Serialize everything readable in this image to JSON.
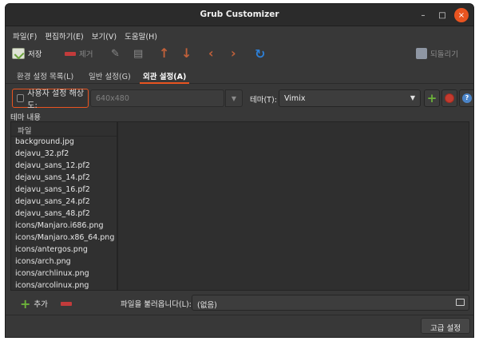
{
  "window": {
    "title": "Grub Customizer"
  },
  "window_controls": {
    "minimize": "–",
    "maximize": "□",
    "close": "×"
  },
  "menubar": [
    {
      "label": "파일(F)"
    },
    {
      "label": "편집하기(E)"
    },
    {
      "label": "보기(V)"
    },
    {
      "label": "도움말(H)"
    }
  ],
  "toolbar": {
    "save_label": "저장",
    "remove_label": "제거",
    "revert_label": "되돌리기",
    "icons": [
      "save-icon",
      "remove-icon",
      "edit-icon",
      "create-entry-icon",
      "arrow-up-icon",
      "arrow-down-icon",
      "arrow-left-icon",
      "arrow-right-icon",
      "reload-icon",
      "revert-icon"
    ]
  },
  "tabs": [
    {
      "label": "환경 설정 목록(L)",
      "active": false
    },
    {
      "label": "일반 설정(G)",
      "active": false
    },
    {
      "label": "외관 설정(A)",
      "active": true
    }
  ],
  "appearance": {
    "custom_resolution_label": "사용자 설정 해상도:",
    "custom_resolution_checked": false,
    "resolution_placeholder": "640x480",
    "theme_label": "테마(T):",
    "theme_value": "Vimix"
  },
  "theme_contents": {
    "section_label": "테마 내용",
    "column_header": "파일",
    "files": [
      "background.jpg",
      "dejavu_32.pf2",
      "dejavu_sans_12.pf2",
      "dejavu_sans_14.pf2",
      "dejavu_sans_16.pf2",
      "dejavu_sans_24.pf2",
      "dejavu_sans_48.pf2",
      "icons/Manjaro.i686.png",
      "icons/Manjaro.x86_64.png",
      "icons/antergos.png",
      "icons/arch.png",
      "icons/archlinux.png",
      "icons/arcolinux.png"
    ],
    "add_label": "추가",
    "load_file_label": "파일을 불러옵니다(L):",
    "load_file_value": "(없음)"
  },
  "advanced_button_label": "고급 설정",
  "colors": {
    "accent": "#e95420",
    "window_bg": "#383838",
    "titlebar_bg": "#2b2b2b"
  }
}
